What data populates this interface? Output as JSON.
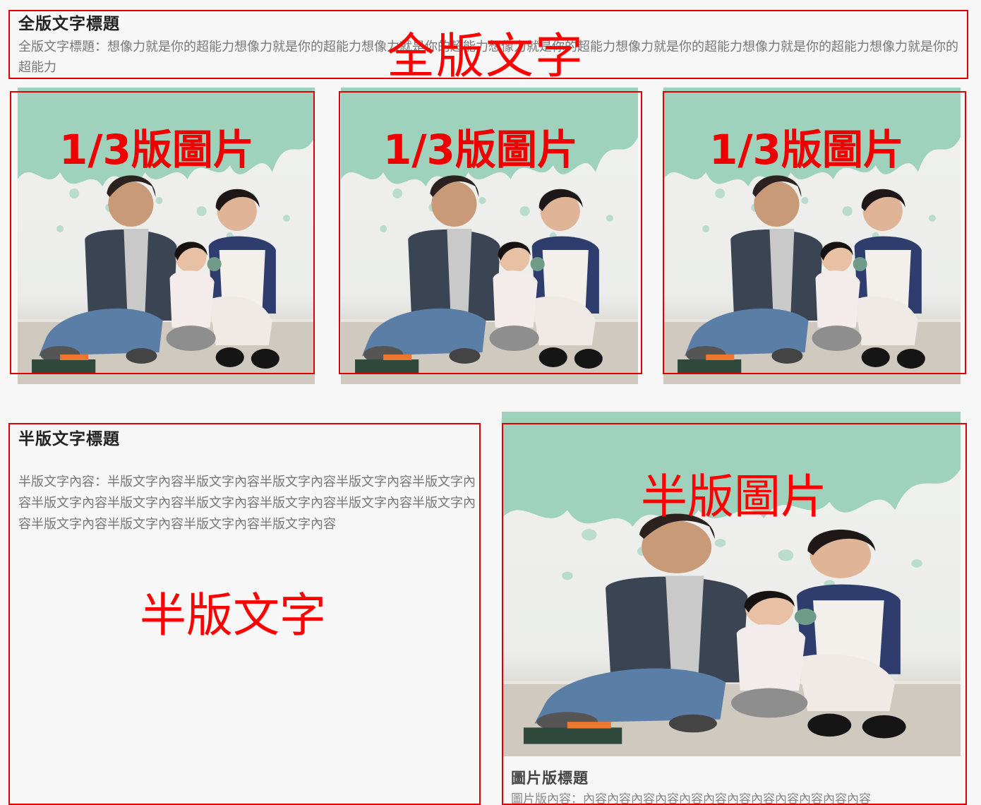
{
  "full_section": {
    "title": "全版文字標題",
    "body": "全版文字標題：想像力就是你的超能力想像力就是你的超能力想像力就是你的超能力想像力就是你的超能力想像力就是你的超能力想像力就是你的超能力想像力就是你的超能力",
    "annotation": "全版文字"
  },
  "third_section": {
    "annotation_1": "1/3版圖片",
    "annotation_2": "1/3版圖片",
    "annotation_3": "1/3版圖片"
  },
  "half_text_section": {
    "title": "半版文字標題",
    "body": "半版文字內容：半版文字內容半版文字內容半版文字內容半版文字內容半版文字內容半版文字內容半版文字內容半版文字內容半版文字內容半版文字內容半版文字內容半版文字內容半版文字內容半版文字內容半版文字內容",
    "annotation": "半版文字"
  },
  "half_image_section": {
    "annotation": "半版圖片",
    "caption_title": "圖片版標題",
    "caption_body": "圖片版內容：內容內容內容內容內容內容內容內容內容內容內容內容"
  },
  "colors": {
    "annotation_red": "#ff0000",
    "paint_green": "#8fcdb4",
    "background": "#f7f7f7"
  }
}
